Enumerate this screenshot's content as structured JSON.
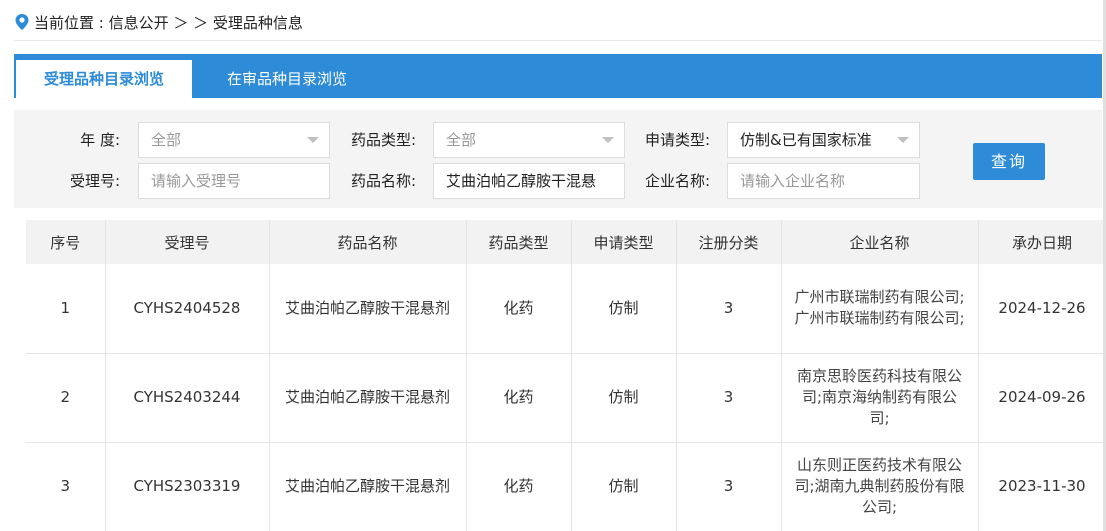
{
  "breadcrumb": {
    "prefix": "当前位置 : 信息公开 ＞ ＞ 受理品种信息"
  },
  "tabs": [
    {
      "label": "受理品种目录浏览",
      "active": true
    },
    {
      "label": "在审品种目录浏览",
      "active": false
    }
  ],
  "filters": {
    "year_label": "年  度:",
    "year_value": "全部",
    "drug_type_label": "药品类型:",
    "drug_type_value": "全部",
    "apply_type_label": "申请类型:",
    "apply_type_value": "仿制&已有国家标准",
    "accept_no_label": "受理号:",
    "accept_no_placeholder": "请输入受理号",
    "drug_name_label": "药品名称:",
    "drug_name_value": "艾曲泊帕乙醇胺干混悬",
    "company_label": "企业名称:",
    "company_placeholder": "请输入企业名称",
    "query_button": "查询"
  },
  "table": {
    "headers": [
      "序号",
      "受理号",
      "药品名称",
      "药品类型",
      "申请类型",
      "注册分类",
      "企业名称",
      "承办日期"
    ],
    "rows": [
      [
        "1",
        "CYHS2404528",
        "艾曲泊帕乙醇胺干混悬剂",
        "化药",
        "仿制",
        "3",
        "广州市联瑞制药有限公司;广州市联瑞制药有限公司;",
        "2024-12-26"
      ],
      [
        "2",
        "CYHS2403244",
        "艾曲泊帕乙醇胺干混悬剂",
        "化药",
        "仿制",
        "3",
        "南京思聆医药科技有限公司;南京海纳制药有限公司;",
        "2024-09-26"
      ],
      [
        "3",
        "CYHS2303319",
        "艾曲泊帕乙醇胺干混悬剂",
        "化药",
        "仿制",
        "3",
        "山东则正医药技术有限公司;湖南九典制药股份有限公司;",
        "2023-11-30"
      ]
    ]
  },
  "colors": {
    "accent": "#2d8bd8",
    "pin": "#2d8bd8"
  }
}
